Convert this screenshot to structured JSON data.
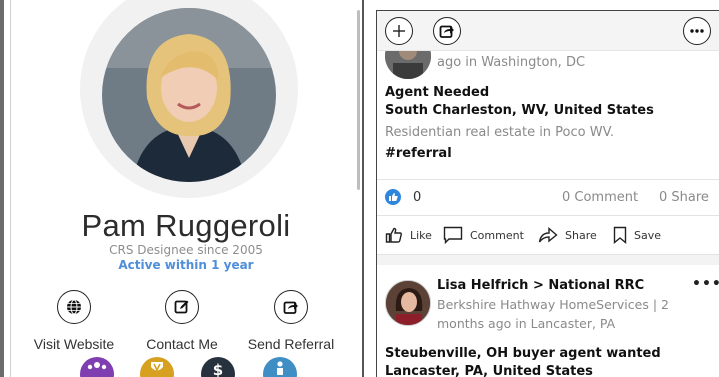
{
  "profile": {
    "name": "Pam Ruggeroli",
    "designation": "CRS Designee since 2005",
    "activity": "Active within 1 year",
    "actions": {
      "website": "Visit Website",
      "contact": "Contact Me",
      "referral": "Send Referral"
    },
    "badge_icons": [
      "group-icon",
      "shield-v-icon",
      "dollar-icon",
      "podium-person-icon"
    ],
    "colors": {
      "active": "#4f8ed9",
      "badge1": "#7f3fb0",
      "badge2": "#d8a021",
      "badge3": "#27323f",
      "badge4": "#3f8ec4"
    }
  },
  "feed": {
    "toolbar_icons": [
      "add-icon",
      "share-icon",
      "more-icon"
    ],
    "post1": {
      "meta": "ago in Washington, DC",
      "title": "Agent Needed",
      "location": "South Charleston, WV, United States",
      "description": "Residentian real estate in Poco WV.",
      "tag": "#referral",
      "likes": "0",
      "comments": "0 Comment",
      "shares": "0 Share"
    },
    "action_labels": {
      "like": "Like",
      "comment": "Comment",
      "share": "Share",
      "save": "Save"
    },
    "post2": {
      "author": "Lisa Helfrich > National RRC",
      "meta_line1": "Berkshire Hathway HomeServices | 2",
      "meta_line2": "months ago in Lancaster, PA",
      "more": "•••",
      "title": "Steubenville, OH buyer agent wanted",
      "location": "Lancaster, PA, United States"
    },
    "colors": {
      "like_blue": "#2e86de"
    }
  }
}
